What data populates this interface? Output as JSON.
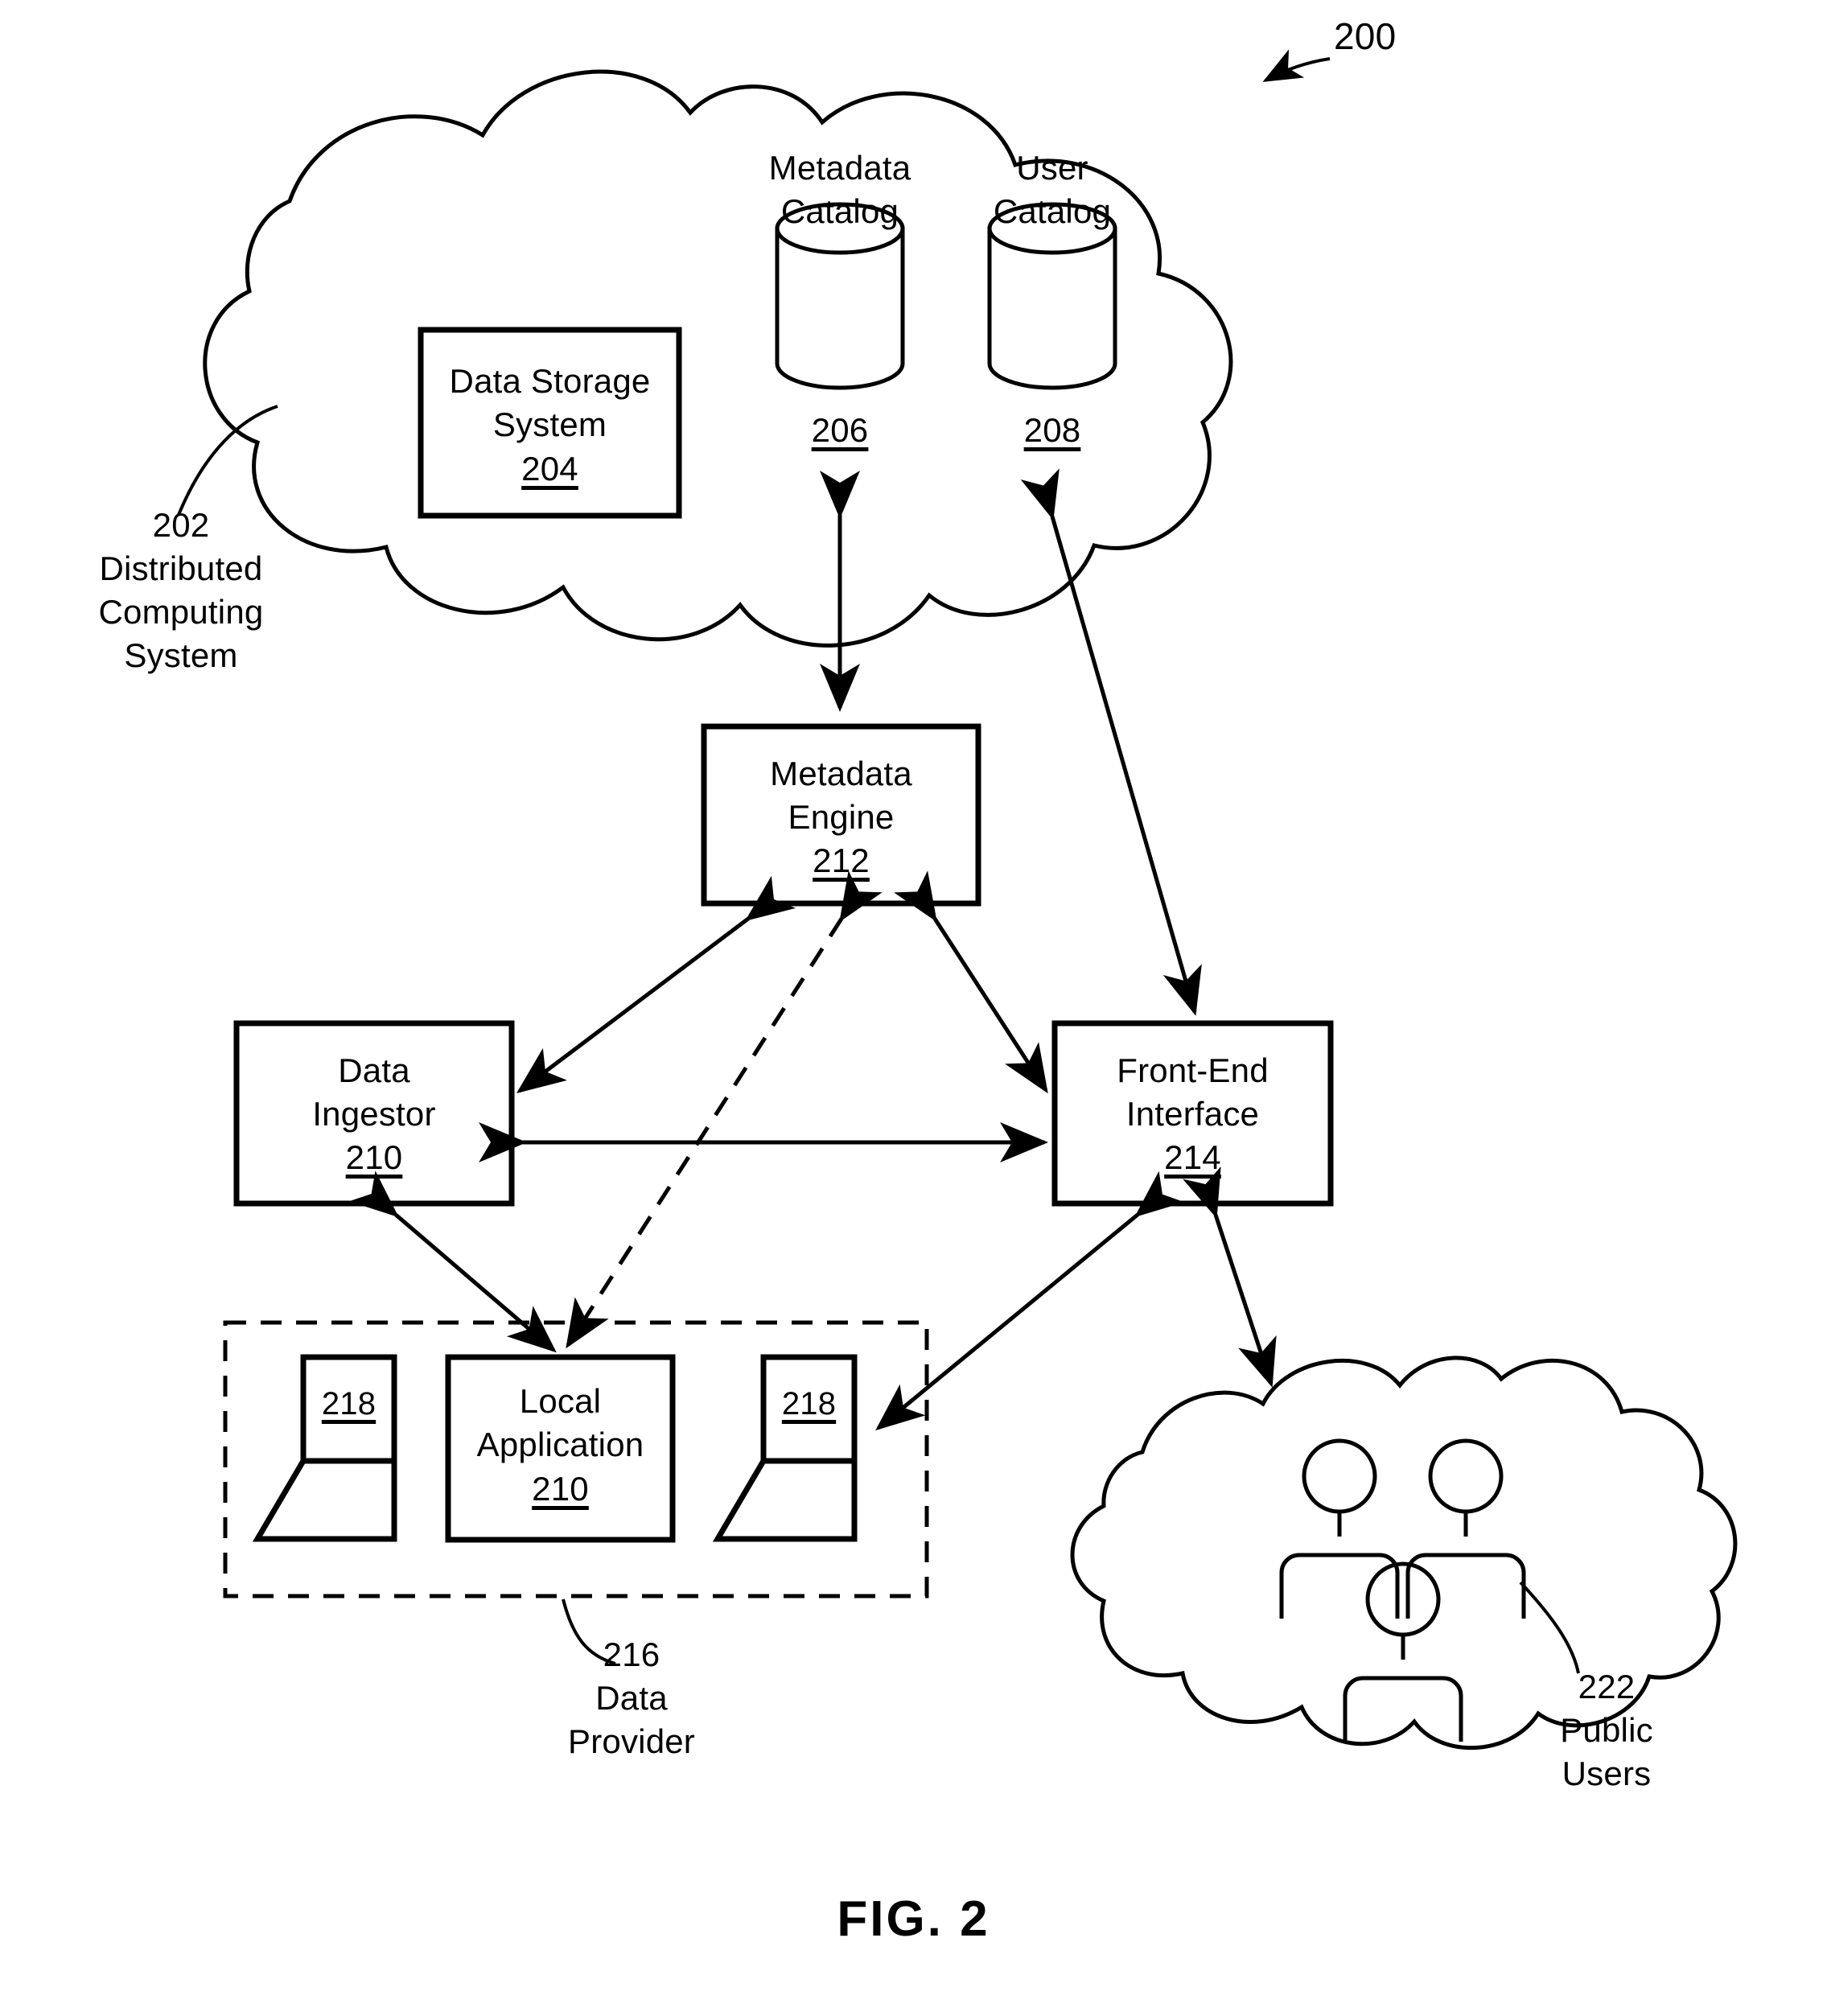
{
  "figure": {
    "caption": "FIG. 2",
    "overall_ref": "200"
  },
  "cloud_system": {
    "ref": "202",
    "name_line1": "Distributed",
    "name_line2": "Computing",
    "name_line3": "System",
    "label_full": "202\nDistributed\nComputing\nSystem"
  },
  "nodes": {
    "data_storage_system": {
      "title_line1": "Data Storage",
      "title_line2": "System",
      "ref": "204"
    },
    "metadata_catalog": {
      "title_line1": "Metadata",
      "title_line2": "Catalog",
      "ref": "206"
    },
    "user_catalog": {
      "title_line1": "User",
      "title_line2": "Catalog",
      "ref": "208"
    },
    "data_ingestor": {
      "title_line1": "Data",
      "title_line2": "Ingestor",
      "ref": "210"
    },
    "metadata_engine": {
      "title_line1": "Metadata",
      "title_line2": "Engine",
      "ref": "212"
    },
    "front_end_interface": {
      "title_line1": "Front-End",
      "title_line2": "Interface",
      "ref": "214"
    },
    "local_application": {
      "title_line1": "Local",
      "title_line2": "Application",
      "ref": "210"
    },
    "data_provider": {
      "ref": "216",
      "name_line1": "Data",
      "name_line2": "Provider",
      "label_full": "216\nData\nProvider"
    },
    "client_device_left": {
      "ref": "218"
    },
    "client_device_right": {
      "ref": "218"
    },
    "public_users": {
      "ref": "222",
      "name_line1": "Public",
      "name_line2": "Users",
      "label_full": "222\nPublic\nUsers"
    }
  },
  "colors": {
    "line": "#000000",
    "background": "#ffffff"
  }
}
